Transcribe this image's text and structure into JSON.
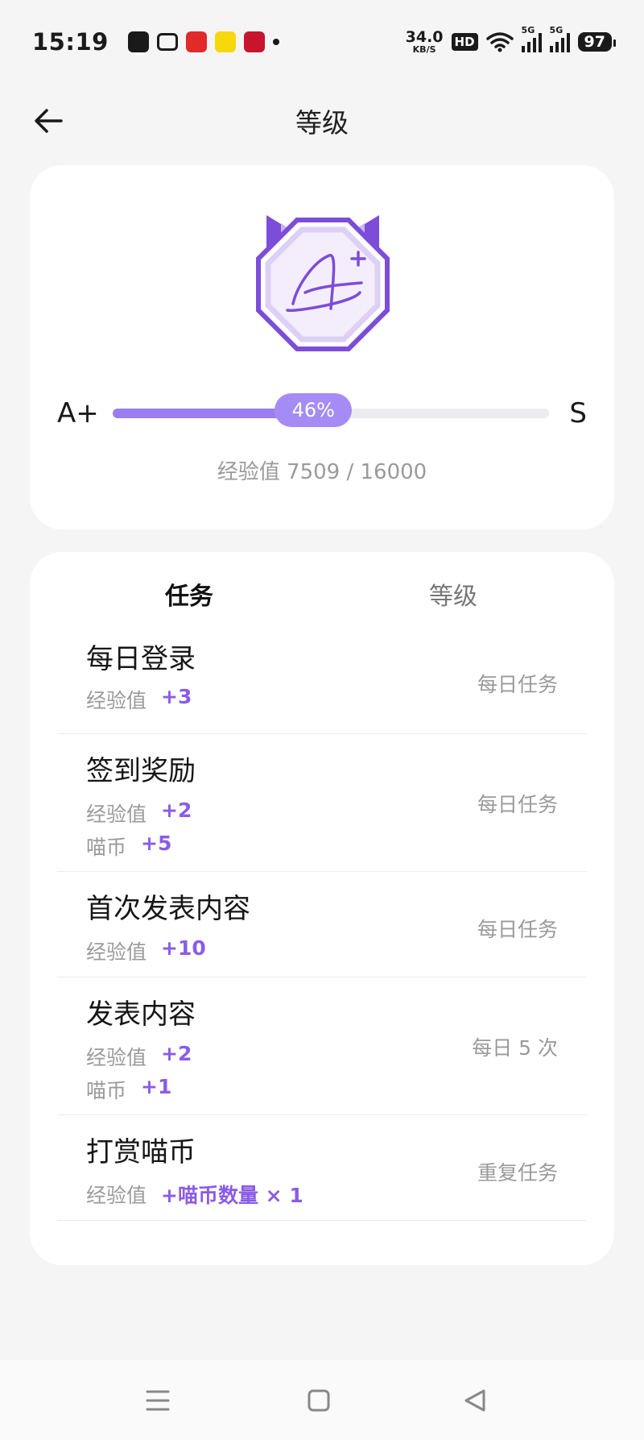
{
  "status_bar": {
    "time": "15:19",
    "net_speed_value": "34.0",
    "net_speed_unit": "KB/S",
    "hd_label": "HD",
    "signal_1": "5G",
    "signal_2": "5G",
    "battery": "97"
  },
  "header": {
    "title": "等级",
    "back_icon": "arrow-left-icon"
  },
  "level": {
    "current_grade": "A+",
    "next_grade": "S",
    "progress_percent": 46,
    "progress_label": "46%",
    "exp_text": "经验值 7509 / 16000",
    "badge_letter": "A",
    "badge_sup": "+",
    "colors": {
      "accent": "#8a5ce6",
      "fill": "#9a7ef0",
      "pill": "#a58cf5"
    }
  },
  "tabs": [
    {
      "label": "任务",
      "active": true
    },
    {
      "label": "等级",
      "active": false
    }
  ],
  "tasks": [
    {
      "name": "每日登录",
      "type": "每日任务",
      "rewards": [
        {
          "label": "经验值",
          "value": "+3"
        }
      ]
    },
    {
      "name": "签到奖励",
      "type": "每日任务",
      "rewards": [
        {
          "label": "经验值",
          "value": "+2"
        },
        {
          "label": "喵币",
          "value": "+5"
        }
      ]
    },
    {
      "name": "首次发表内容",
      "type": "每日任务",
      "rewards": [
        {
          "label": "经验值",
          "value": "+10"
        }
      ]
    },
    {
      "name": "发表内容",
      "type": "每日 5 次",
      "rewards": [
        {
          "label": "经验值",
          "value": "+2"
        },
        {
          "label": "喵币",
          "value": "+1"
        }
      ]
    },
    {
      "name": "打赏喵币",
      "type": "重复任务",
      "rewards": [
        {
          "label": "经验值",
          "value": "+喵币数量 × 1"
        }
      ]
    }
  ],
  "nav": {
    "menu_icon": "menu-icon",
    "home_icon": "home-square-icon",
    "back_icon": "back-triangle-icon"
  }
}
